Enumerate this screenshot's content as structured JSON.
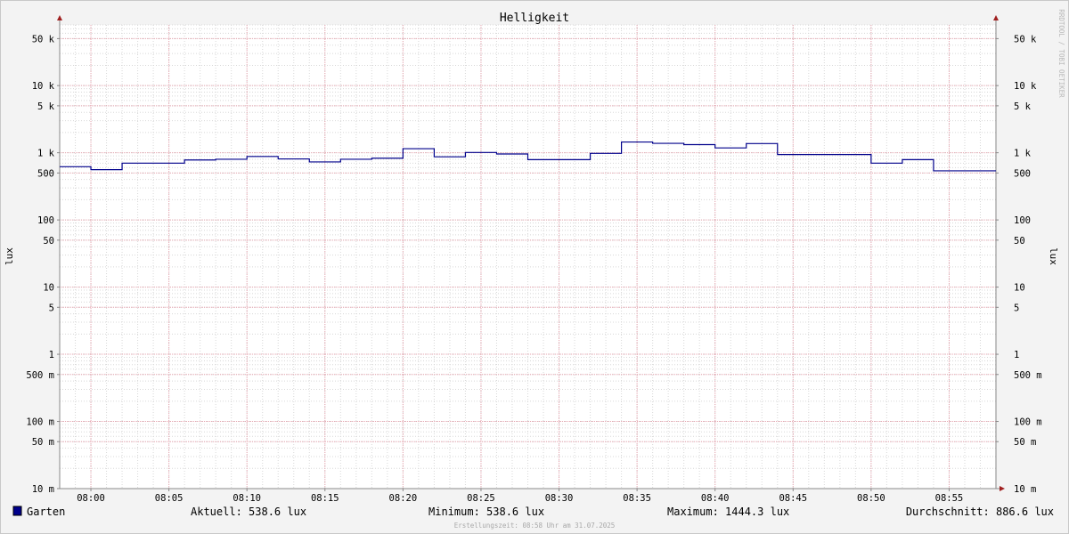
{
  "watermark": "RRDTOOL / TOBI OETIKER",
  "footer": {
    "created": "Erstellungszeit: 08:58 Uhr am 31.07.2025"
  },
  "legend": {
    "series_name": "Garten",
    "current": "Aktuell: 538.6 lux",
    "minimum": "Minimum: 538.6 lux",
    "maximum": "Maximum: 1444.3 lux",
    "average": "Durchschnitt: 886.6 lux"
  },
  "colors": {
    "background": "#f3f3f3",
    "canvas": "#ffffff",
    "series": "#00008b",
    "major_grid": "#e8a6b1",
    "minor_grid": "#d8d8d8",
    "axis": "#888888",
    "arrow": "#a02020"
  },
  "chart_data": {
    "type": "line",
    "title": "Helligkeit",
    "ylabel": "lux",
    "ylabel_right": "lux",
    "y_scale": "log",
    "ylim": [
      0.01,
      80000
    ],
    "grid": true,
    "legend_position": "bottom",
    "x_time_range": [
      "07:58",
      "08:58"
    ],
    "x_ticks": [
      "08:00",
      "08:05",
      "08:10",
      "08:15",
      "08:20",
      "08:25",
      "08:30",
      "08:35",
      "08:40",
      "08:45",
      "08:50",
      "08:55"
    ],
    "y_ticks": [
      {
        "value": 50000,
        "label": "50 k"
      },
      {
        "value": 10000,
        "label": "10 k"
      },
      {
        "value": 5000,
        "label": "5 k"
      },
      {
        "value": 1000,
        "label": "1 k"
      },
      {
        "value": 500,
        "label": "500"
      },
      {
        "value": 100,
        "label": "100"
      },
      {
        "value": 50,
        "label": "50"
      },
      {
        "value": 10,
        "label": "10"
      },
      {
        "value": 5,
        "label": "5"
      },
      {
        "value": 1,
        "label": "1"
      },
      {
        "value": 0.5,
        "label": "500 m"
      },
      {
        "value": 0.1,
        "label": "100 m"
      },
      {
        "value": 0.05,
        "label": "50 m"
      },
      {
        "value": 0.01,
        "label": "10 m"
      }
    ],
    "series": [
      {
        "name": "Garten",
        "step": true,
        "points": [
          {
            "t": "07:58",
            "v": 620
          },
          {
            "t": "08:00",
            "v": 560
          },
          {
            "t": "08:02",
            "v": 700
          },
          {
            "t": "08:06",
            "v": 780
          },
          {
            "t": "08:08",
            "v": 800
          },
          {
            "t": "08:10",
            "v": 880
          },
          {
            "t": "08:12",
            "v": 810
          },
          {
            "t": "08:14",
            "v": 730
          },
          {
            "t": "08:16",
            "v": 800
          },
          {
            "t": "08:18",
            "v": 830
          },
          {
            "t": "08:20",
            "v": 1150
          },
          {
            "t": "08:22",
            "v": 870
          },
          {
            "t": "08:24",
            "v": 1010
          },
          {
            "t": "08:26",
            "v": 960
          },
          {
            "t": "08:28",
            "v": 790
          },
          {
            "t": "08:32",
            "v": 980
          },
          {
            "t": "08:34",
            "v": 1444.3
          },
          {
            "t": "08:36",
            "v": 1380
          },
          {
            "t": "08:38",
            "v": 1320
          },
          {
            "t": "08:40",
            "v": 1180
          },
          {
            "t": "08:42",
            "v": 1370
          },
          {
            "t": "08:44",
            "v": 940
          },
          {
            "t": "08:50",
            "v": 700
          },
          {
            "t": "08:52",
            "v": 790
          },
          {
            "t": "08:54",
            "v": 538.6
          },
          {
            "t": "08:58",
            "v": 538.6
          }
        ]
      }
    ]
  }
}
